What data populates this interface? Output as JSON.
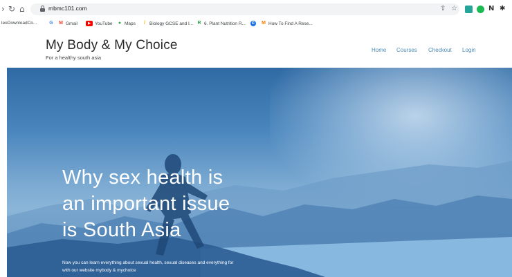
{
  "browser": {
    "url": "mbmc101.com",
    "bookmarks": [
      {
        "label": "leoDownloadCo...",
        "icon": "download-icon",
        "color": ""
      },
      {
        "label": "",
        "icon": "google-icon",
        "color": "#4285f4"
      },
      {
        "label": "Gmail",
        "icon": "gmail-icon",
        "color": "#ea4335"
      },
      {
        "label": "YouTube",
        "icon": "youtube-icon",
        "color": "#ff0000"
      },
      {
        "label": "Maps",
        "icon": "maps-icon",
        "color": "#34a853"
      },
      {
        "label": "Biology GCSE and I...",
        "icon": "biology-icon",
        "color": "#f4b400"
      },
      {
        "label": "6. Plant Nutrition R...",
        "icon": "plant-icon",
        "color": "#34a853"
      },
      {
        "label": "",
        "icon": "chrome-icon",
        "color": "#1a73e8"
      },
      {
        "label": "How To Find A Rese...",
        "icon": "research-icon",
        "color": "#f57c00"
      }
    ]
  },
  "site": {
    "title": "My Body & My Choice",
    "tagline": "For a healthy south asia",
    "nav": [
      "Home",
      "Courses",
      "Checkout",
      "Login"
    ]
  },
  "hero": {
    "heading_lines": [
      "Why sex health is",
      "an important issue",
      "is South Asia"
    ],
    "sub_lines": [
      "Now you can learn everything about sexual health, sexual diseases and everything for",
      "with our website mybody & mychoice"
    ]
  },
  "colors": {
    "nav_link": "#4a8bb8",
    "hero_top": "#2f6aa4",
    "hero_bottom": "#5a8dbd"
  }
}
